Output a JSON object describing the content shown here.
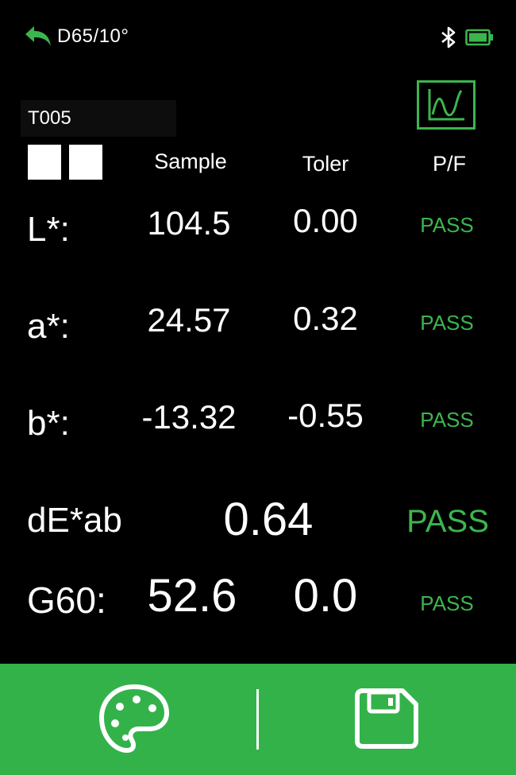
{
  "status_bar": {
    "illuminant": "D65/10°",
    "icons": [
      "back-arrow-icon",
      "bluetooth-icon",
      "battery-icon"
    ]
  },
  "toolbar": {
    "chart_icon": "spectral-curve-icon"
  },
  "sample": {
    "id": "T005"
  },
  "columns": {
    "sample": "Sample",
    "tolerance": "Toler",
    "pass_fail": "P/F"
  },
  "rows": [
    {
      "label": "L*:",
      "sample": "104.5",
      "tolerance": "0.00",
      "result": "PASS"
    },
    {
      "label": "a*:",
      "sample": "24.57",
      "tolerance": "0.32",
      "result": "PASS"
    },
    {
      "label": "b*:",
      "sample": "-13.32",
      "tolerance": "-0.55",
      "result": "PASS"
    }
  ],
  "delta_e": {
    "label": "dE*ab",
    "value": "0.64",
    "result": "PASS"
  },
  "gloss": {
    "label": "G60:",
    "sample": "52.6",
    "tolerance": "0.0",
    "result": "PASS"
  },
  "bottom_bar": {
    "icons": [
      "palette-icon",
      "save-icon"
    ]
  },
  "colors": {
    "background": "#000000",
    "accent": "#33b24a",
    "pass": "#3cb54e",
    "text": "#ffffff"
  }
}
